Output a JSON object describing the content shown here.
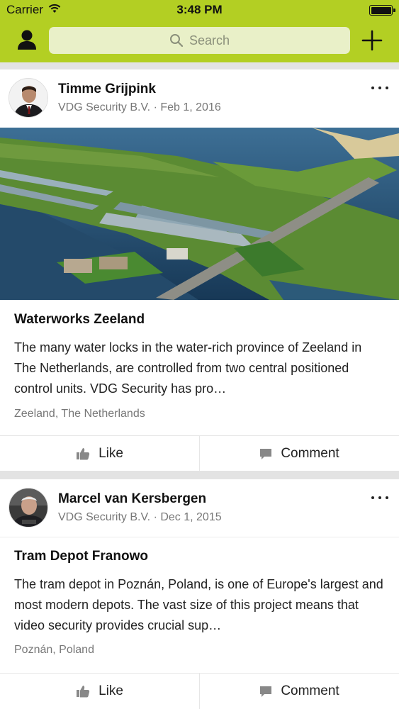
{
  "status_bar": {
    "carrier": "Carrier",
    "time": "3:48 PM",
    "battery_level": 1.0
  },
  "header": {
    "search_placeholder": "Search",
    "profile_icon": "person-icon",
    "add_icon": "plus-icon"
  },
  "colors": {
    "accent": "#b3cf23",
    "search_bg": "#e9f0c8",
    "feed_bg": "#e3e3e3"
  },
  "posts": [
    {
      "author": "Timme Grijpink",
      "meta": "VDG Security B.V. · Feb 1, 2016",
      "title": "Waterworks Zeeland",
      "body": "The many water locks in the water-rich province of Zeeland in The Netherlands, are controlled from two central positioned control units. VDG Security has pro…",
      "location": "Zeeland, The Netherlands",
      "like_label": "Like",
      "comment_label": "Comment"
    },
    {
      "author": "Marcel van Kersbergen",
      "meta": "VDG Security B.V. · Dec 1, 2015",
      "title": "Tram Depot Franowo",
      "body": "The tram depot in Poznán, Poland, is one of Europe's largest and most modern depots. The vast size of this project means that video security provides crucial sup…",
      "location": "Poznán, Poland",
      "like_label": "Like",
      "comment_label": "Comment"
    }
  ]
}
